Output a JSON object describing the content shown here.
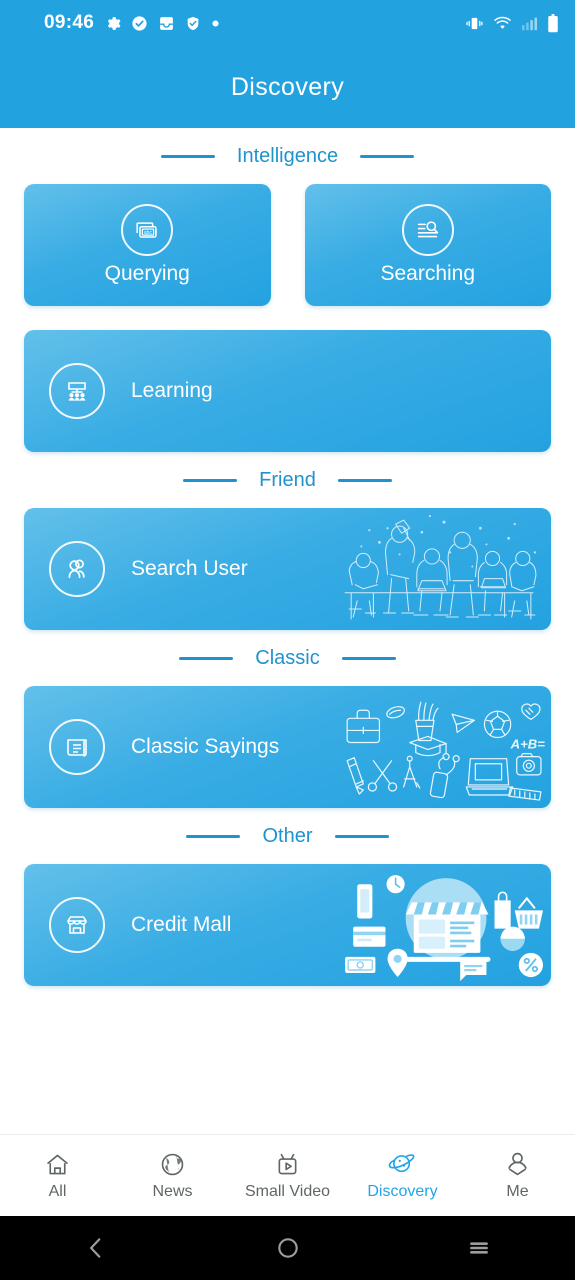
{
  "status_bar": {
    "time": "09:46",
    "left_icons": [
      "gear-icon",
      "check-circle-icon",
      "inbox-icon",
      "shield-check-icon",
      "dot-icon"
    ],
    "right_icons": [
      "vibrate-icon",
      "wifi-icon",
      "signal-icon",
      "battery-icon"
    ]
  },
  "header": {
    "title": "Discovery"
  },
  "theme": {
    "accent": "#23a2e0",
    "section_label": "#1f93cf",
    "card_gradient_from": "#63c0ea",
    "card_gradient_to": "#23a2e0",
    "tab_active": "#1fa6e8",
    "tab_inactive": "#5f6668"
  },
  "sections": [
    {
      "label": "Intelligence",
      "items": [
        {
          "label": "Querying",
          "icon": "abc-cards-icon",
          "layout": "square"
        },
        {
          "label": "Searching",
          "icon": "document-search-icon",
          "layout": "square"
        },
        {
          "label": "Learning",
          "icon": "classroom-icon",
          "layout": "wide"
        }
      ]
    },
    {
      "label": "Friend",
      "items": [
        {
          "label": "Search User",
          "icon": "two-users-icon",
          "layout": "wide",
          "art": "team-meeting-illustration"
        }
      ]
    },
    {
      "label": "Classic",
      "items": [
        {
          "label": "Classic Sayings",
          "icon": "scroll-document-icon",
          "layout": "wide",
          "art": "school-supplies-doodles"
        }
      ]
    },
    {
      "label": "Other",
      "items": [
        {
          "label": "Credit Mall",
          "icon": "storefront-icon",
          "layout": "wide",
          "art": "ecommerce-illustration"
        }
      ]
    }
  ],
  "tabbar": {
    "active_index": 3,
    "items": [
      {
        "label": "All",
        "icon": "home-icon"
      },
      {
        "label": "News",
        "icon": "globe-icon"
      },
      {
        "label": "Small Video",
        "icon": "tv-play-icon"
      },
      {
        "label": "Discovery",
        "icon": "planet-icon"
      },
      {
        "label": "Me",
        "icon": "person-icon"
      }
    ]
  },
  "system_nav": {
    "buttons": [
      "back-icon",
      "home-circle-icon",
      "recents-icon"
    ]
  }
}
